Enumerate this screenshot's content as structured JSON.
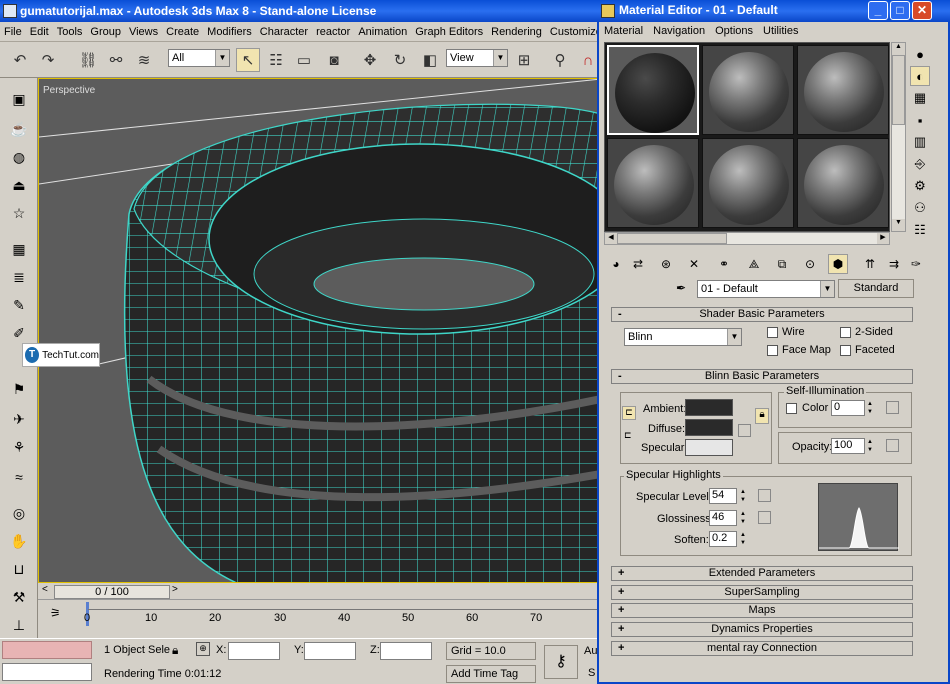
{
  "max": {
    "title": "gumatutorijal.max - Autodesk 3ds Max 8   - Stand-alone License",
    "menu": [
      "File",
      "Edit",
      "Tools",
      "Group",
      "Views",
      "Create",
      "Modifiers",
      "Character",
      "reactor",
      "Animation",
      "Graph Editors",
      "Rendering",
      "Customize"
    ],
    "toolbar": {
      "selection_filter": "All",
      "ref_coord": "View"
    },
    "viewport_label": "Perspective",
    "watermark": "TechTut.com",
    "time_slider": "0 / 100",
    "track_ticks": [
      "0",
      "10",
      "20",
      "30",
      "40",
      "50",
      "60",
      "70"
    ],
    "status": {
      "selection": "1 Object Sele",
      "x_label": "X:",
      "y_label": "Y:",
      "z_label": "Z:",
      "grid": "Grid = 10.0",
      "render_time": "Rendering Time  0:01:12",
      "add_time_tag": "Add Time Tag",
      "auto": "Au",
      "s": "S"
    }
  },
  "me": {
    "title": "Material Editor - 01 - Default",
    "menu": [
      "Material",
      "Navigation",
      "Options",
      "Utilities"
    ],
    "material_name": "01 - Default",
    "material_type": "Standard",
    "shader_rollout": "Shader Basic Parameters",
    "shader": "Blinn",
    "wire": "Wire",
    "two_sided": "2-Sided",
    "face_map": "Face Map",
    "faceted": "Faceted",
    "blinn_rollout": "Blinn Basic Parameters",
    "self_illum": "Self-Illumination",
    "color": "Color",
    "color_value": "0",
    "ambient": "Ambient:",
    "diffuse": "Diffuse:",
    "specular": "Specular:",
    "opacity_label": "Opacity:",
    "opacity": "100",
    "spec_highlights": "Specular Highlights",
    "spec_level_label": "Specular Level:",
    "spec_level": "54",
    "glossiness_label": "Glossiness:",
    "glossiness": "46",
    "soften_label": "Soften:",
    "soften": "0.2",
    "rollouts": [
      "Extended Parameters",
      "SuperSampling",
      "Maps",
      "Dynamics Properties",
      "mental ray Connection"
    ],
    "colors": {
      "ambient": "#2a2a2a",
      "diffuse": "#2a2a2a",
      "specular": "#e6e6e6"
    }
  }
}
